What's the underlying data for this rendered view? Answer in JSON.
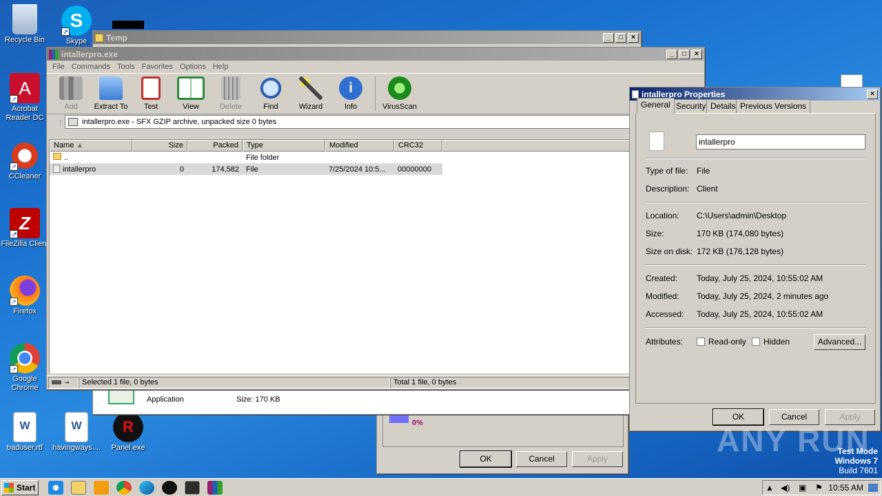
{
  "desktop": {
    "icons": [
      {
        "label": "Recycle Bin",
        "icon": "recycle-bin-icon"
      },
      {
        "label": "Skype",
        "icon": "skype-icon"
      },
      {
        "label": "Acrobat Reader DC",
        "icon": "acrobat-icon"
      },
      {
        "label": "CCleaner",
        "icon": "ccleaner-icon"
      },
      {
        "label": "FileZilla Client",
        "icon": "filezilla-icon"
      },
      {
        "label": "Firefox",
        "icon": "firefox-icon"
      },
      {
        "label": "Google Chrome",
        "icon": "chrome-icon"
      },
      {
        "label": "baduser.rtf",
        "icon": "word-doc-icon"
      },
      {
        "label": "havingways....",
        "icon": "word-doc-icon"
      },
      {
        "label": "Panel.exe",
        "icon": "panel-exe-icon"
      }
    ],
    "watermark": {
      "brand": "ANY RUN",
      "line1": "Test Mode",
      "line2": "Windows 7",
      "line3": "Build 7601"
    }
  },
  "temp_window": {
    "title": "Temp",
    "file_type_text": "Application",
    "size_text": "Size: 170 KB"
  },
  "back_dialog": {
    "progress_text": "0%",
    "ok": "OK",
    "cancel": "Cancel",
    "apply": "Apply"
  },
  "winrar": {
    "title": "intallerpro.exe",
    "menu": [
      "File",
      "Commands",
      "Tools",
      "Favorites",
      "Options",
      "Help"
    ],
    "toolbar": [
      {
        "label": "Add",
        "icon": "add-archive-icon",
        "disabled": true
      },
      {
        "label": "Extract To",
        "icon": "extract-folder-icon",
        "disabled": false
      },
      {
        "label": "Test",
        "icon": "test-clipboard-icon",
        "disabled": false
      },
      {
        "label": "View",
        "icon": "view-book-icon",
        "disabled": false
      },
      {
        "label": "Delete",
        "icon": "trash-icon",
        "disabled": true
      },
      {
        "label": "Find",
        "icon": "magnifier-icon",
        "disabled": false
      },
      {
        "label": "Wizard",
        "icon": "wand-icon",
        "disabled": false
      },
      {
        "label": "Info",
        "icon": "info-icon",
        "disabled": false
      },
      {
        "label": "VirusScan",
        "icon": "virus-scan-icon",
        "disabled": false
      }
    ],
    "address": "intallerpro.exe - SFX GZIP archive, unpacked size 0 bytes",
    "columns": [
      "Name",
      "Size",
      "Packed",
      "Type",
      "Modified",
      "CRC32"
    ],
    "rows": [
      {
        "name": "..",
        "size": "",
        "packed": "",
        "type": "File folder",
        "modified": "",
        "crc": ""
      },
      {
        "name": "intallerpro",
        "size": "0",
        "packed": "174,582",
        "type": "File",
        "modified": "7/25/2024 10:5...",
        "crc": "00000000"
      }
    ],
    "status_left": "Selected 1 file, 0 bytes",
    "status_right": "Total 1 file, 0 bytes"
  },
  "props": {
    "title": "intallerpro Properties",
    "tabs": [
      "General",
      "Security",
      "Details",
      "Previous Versions"
    ],
    "name_value": "intallerpro",
    "fields": [
      {
        "label": "Type of file:",
        "value": "File"
      },
      {
        "label": "Description:",
        "value": "Client"
      },
      {
        "label": "Location:",
        "value": "C:\\Users\\admin\\Desktop"
      },
      {
        "label": "Size:",
        "value": "170 KB (174,080 bytes)"
      },
      {
        "label": "Size on disk:",
        "value": "172 KB (176,128 bytes)"
      },
      {
        "label": "Created:",
        "value": "Today, July 25, 2024, 10:55:02 AM"
      },
      {
        "label": "Modified:",
        "value": "Today, July 25, 2024, 2 minutes ago"
      },
      {
        "label": "Accessed:",
        "value": "Today, July 25, 2024, 10:55:02 AM"
      }
    ],
    "attributes_label": "Attributes:",
    "readonly_label": "Read-only",
    "hidden_label": "Hidden",
    "advanced": "Advanced...",
    "ok": "OK",
    "cancel": "Cancel",
    "apply": "Apply"
  },
  "taskbar": {
    "start": "Start",
    "clock": "10:55 AM"
  }
}
